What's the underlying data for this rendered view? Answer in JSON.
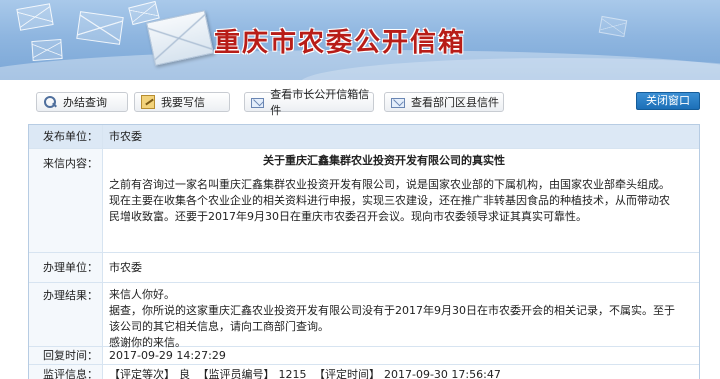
{
  "banner": {
    "title": "重庆市农委公开信箱"
  },
  "toolbar": {
    "buttons": [
      {
        "label": "办结查询",
        "icon": "search-icon"
      },
      {
        "label": "我要写信",
        "icon": "edit-icon"
      },
      {
        "label": "查看市长公开信箱信件",
        "icon": "mail-icon"
      },
      {
        "label": "查看部门区县信件",
        "icon": "mail-icon"
      }
    ],
    "close_label": "关闭窗口"
  },
  "letter": {
    "publisher_label": "发布单位：",
    "publisher": "市农委",
    "content_label": "来信内容：",
    "title": "关于重庆汇鑫集群农业投资开发有限公司的真实性",
    "body": "之前有咨询过一家名叫重庆汇鑫集群农业投资开发有限公司，说是国家农业部的下属机构，由国家农业部牵头组成。现在主要在收集各个农业企业的相关资料进行申报，实现三农建设，还在推广非转基因食品的种植技术，从而带动农民增收致富。还要于2017年9月30日在重庆市农委召开会议。现向市农委领导求证其真实可靠性。",
    "handler_label": "办理单位：",
    "handler": "市农委",
    "result_label": "办理结果：",
    "result_lines": [
      "来信人你好。",
      "据查，你所说的这家重庆汇鑫农业投资开发有限公司没有于2017年9月30日在市农委开会的相关记录，不属实。至于该公司的其它相关信息，请向工商部门查询。",
      "感谢你的来信。"
    ],
    "reply_time_label": "回复时间：",
    "reply_time": "2017-09-29 14:27:29",
    "monitor_label": "监评信息：",
    "monitor": {
      "rating_label": "【评定等次】",
      "rating": "良",
      "supervisor_label": "【监评员编号】",
      "supervisor": "1215",
      "eval_time_label": "【评定时间】",
      "eval_time": "2017-09-30 17:56:47"
    }
  },
  "colors": {
    "title_red": "#b81d18",
    "close_blue": "#1c6fb7",
    "header_row": "#dce8f5"
  }
}
